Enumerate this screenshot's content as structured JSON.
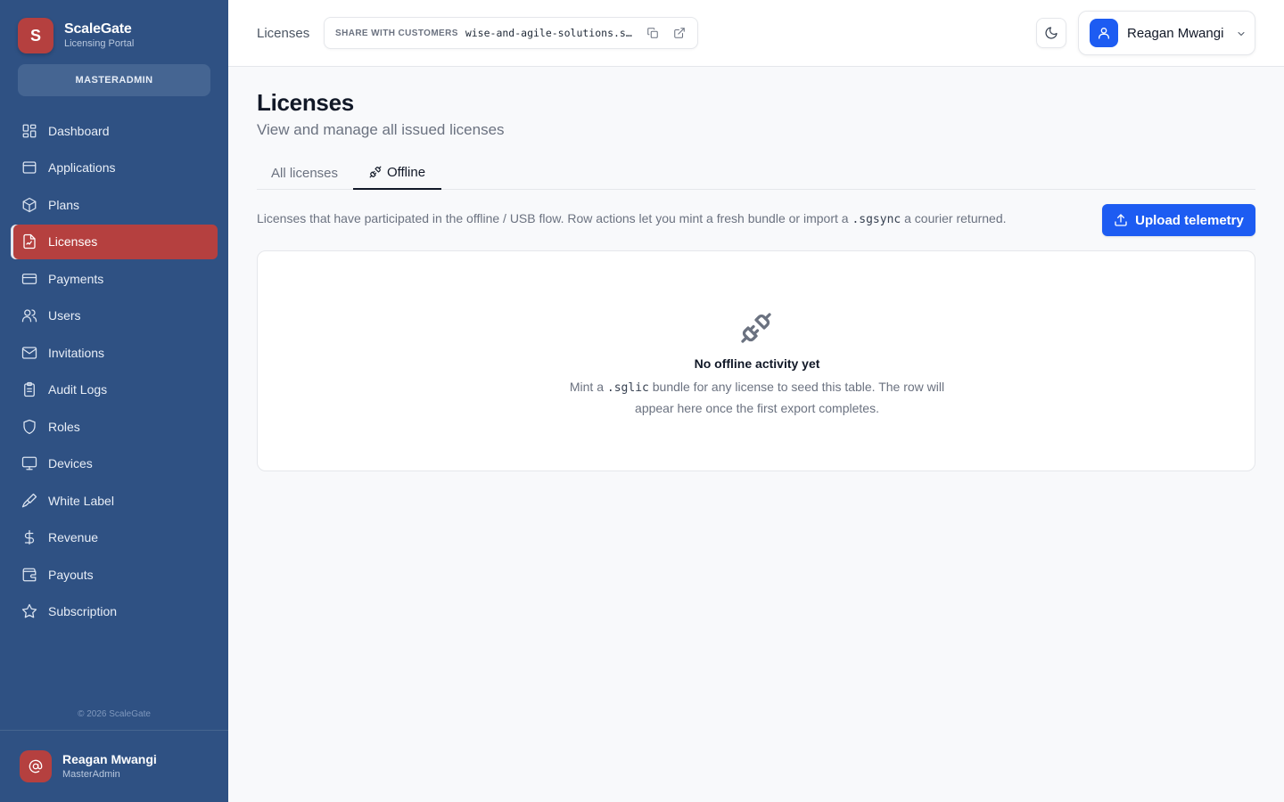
{
  "brand": {
    "initial": "S",
    "name": "ScaleGate",
    "subtitle": "Licensing Portal"
  },
  "role_badge": "MASTERADMIN",
  "sidebar": {
    "items": [
      {
        "label": "Dashboard",
        "icon": "dashboard-icon"
      },
      {
        "label": "Applications",
        "icon": "applications-icon"
      },
      {
        "label": "Plans",
        "icon": "plans-icon"
      },
      {
        "label": "Licenses",
        "icon": "licenses-icon",
        "active": true
      },
      {
        "label": "Payments",
        "icon": "payments-icon"
      },
      {
        "label": "Users",
        "icon": "users-icon"
      },
      {
        "label": "Invitations",
        "icon": "invitations-icon"
      },
      {
        "label": "Audit Logs",
        "icon": "audit-logs-icon"
      },
      {
        "label": "Roles",
        "icon": "roles-icon"
      },
      {
        "label": "Devices",
        "icon": "devices-icon"
      },
      {
        "label": "White Label",
        "icon": "white-label-icon"
      },
      {
        "label": "Revenue",
        "icon": "revenue-icon"
      },
      {
        "label": "Payouts",
        "icon": "payouts-icon"
      },
      {
        "label": "Subscription",
        "icon": "subscription-icon"
      }
    ],
    "copyright": "© 2026 ScaleGate",
    "user": {
      "name": "Reagan Mwangi",
      "role": "MasterAdmin"
    }
  },
  "header": {
    "breadcrumb": "Licenses",
    "share": {
      "label": "SHARE WITH CUSTOMERS",
      "url": "wise-and-agile-solutions.sc..."
    },
    "user_name": "Reagan Mwangi"
  },
  "main": {
    "title": "Licenses",
    "subtitle": "View and manage all issued licenses",
    "tabs": [
      {
        "label": "All licenses"
      },
      {
        "label": "Offline"
      }
    ],
    "description": {
      "before": "Licenses that have participated in the offline / USB flow. Row actions let you mint a fresh bundle or import a",
      "code": ".sgsync",
      "after": "a courier returned."
    },
    "upload_button": "Upload telemetry",
    "empty": {
      "title": "No offline activity yet",
      "text_before": "Mint a",
      "code": ".sglic",
      "text_after": "bundle for any license to seed this table. The row will appear here once the first export completes."
    }
  },
  "colors": {
    "sidebar_bg": "#2f5183",
    "active_item": "#b5403f",
    "primary_button": "#1d5cf2"
  }
}
